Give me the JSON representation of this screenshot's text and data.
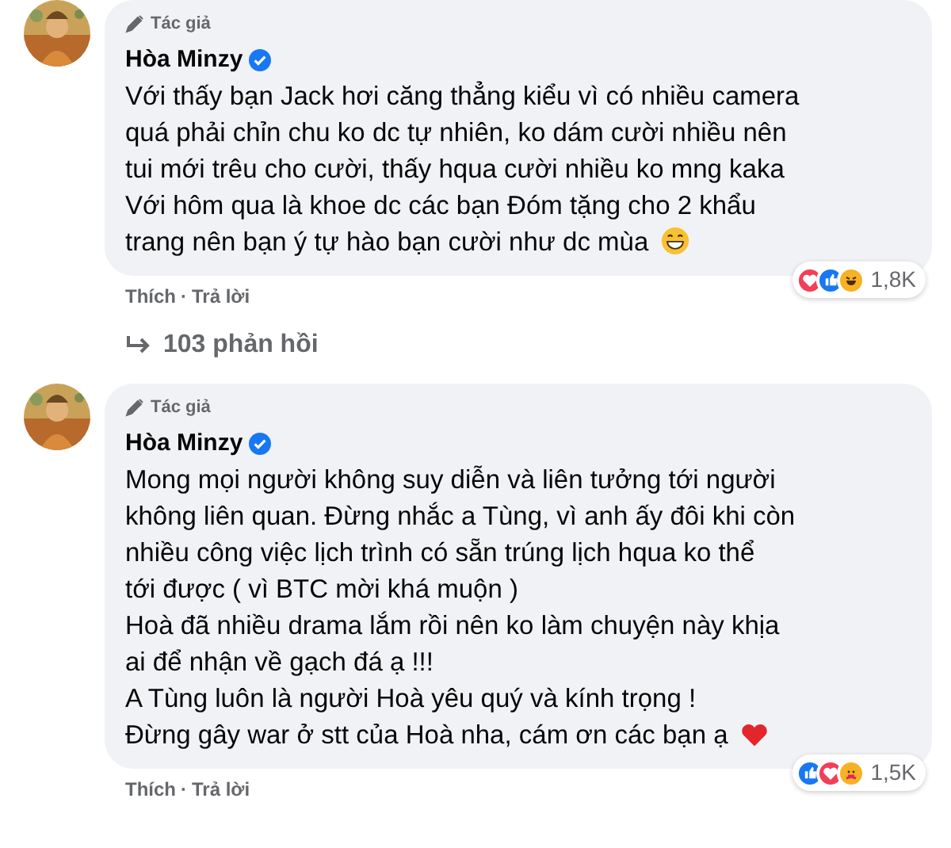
{
  "comments": [
    {
      "badge": "Tác giả",
      "author": "Hòa Minzy",
      "verified": true,
      "lines": [
        "Với thấy bạn Jack hơi căng thẳng kiểu vì có nhiều camera",
        "quá phải chỉn chu ko dc tự nhiên, ko dám cười nhiều nên",
        "tui mới trêu cho cười, thấy hqua cười nhiều ko mng kaka",
        "Với hôm qua là khoe dc các bạn Đóm tặng cho 2 khẩu",
        "trang nên bạn ý tự hào bạn cười như dc mùa"
      ],
      "end_emoji": {
        "kind": "grin"
      },
      "reactions": [
        {
          "kind": "love"
        },
        {
          "kind": "like"
        },
        {
          "kind": "haha"
        }
      ],
      "reaction_count": "1,8K",
      "actions": [
        "Thích",
        "Trả lời"
      ],
      "separator": "·",
      "replies": "103 phản hồi"
    },
    {
      "badge": "Tác giả",
      "author": "Hòa Minzy",
      "verified": true,
      "lines": [
        "Mong mọi người không suy diễn và liên tưởng tới người",
        "không liên quan. Đừng nhắc a Tùng, vì anh ấy đôi khi còn",
        "nhiều công việc lịch trình có sẵn trúng lịch hqua ko thể",
        "tới được ( vì BTC mời khá muộn )",
        "Hoà đã nhiều drama lắm rồi nên ko làm chuyện này khịa",
        "ai để nhận về gạch đá ạ !!!",
        "A Tùng luôn là người Hoà yêu quý và kính trọng !",
        "Đừng gây war ở stt của Hoà nha, cám ơn các bạn ạ"
      ],
      "end_emoji": {
        "kind": "heart"
      },
      "reactions": [
        {
          "kind": "like"
        },
        {
          "kind": "love"
        },
        {
          "kind": "care"
        }
      ],
      "reaction_count": "1,5K",
      "actions": [
        "Thích",
        "Trả lời"
      ],
      "separator": "·"
    }
  ]
}
